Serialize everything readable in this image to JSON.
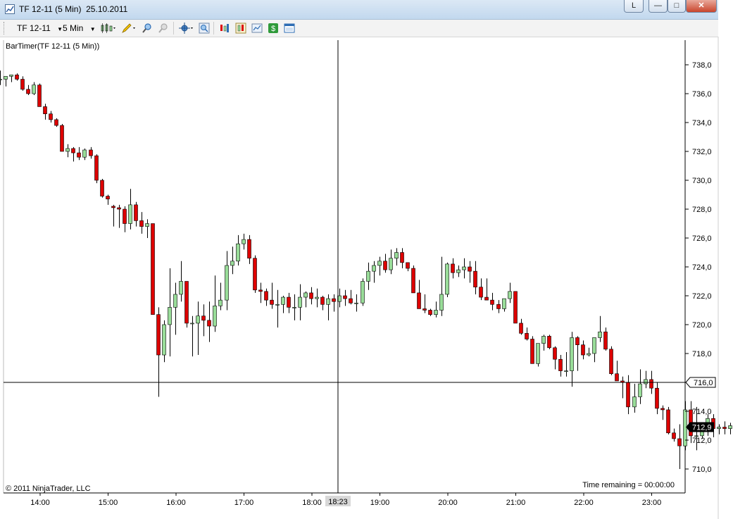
{
  "window": {
    "title": "TF 12-11 (5 Min)  25.10.2011",
    "link_button": "L",
    "minimize_glyph": "—",
    "maximize_glyph": "□",
    "close_glyph": "✕"
  },
  "toolbar": {
    "instrument": "TF 12-11",
    "interval": "5 Min",
    "icons": [
      "chart-style-icon",
      "drawing-pencil-icon",
      "zoom-in-icon",
      "zoom-out-icon",
      "crosshair-icon",
      "properties-icon",
      "indicators-icon",
      "strategies-icon",
      "data-box-icon",
      "dollar-icon",
      "window-icon"
    ]
  },
  "chart": {
    "indicator_label": "BarTimer(TF 12-11 (5 Min))",
    "copyright": "© 2011 NinjaTrader, LLC",
    "time_remaining": "Time remaining = 00:00:00",
    "crosshair_time": "18:23",
    "crosshair_price": "716,0",
    "last_price": "712,9",
    "colors": {
      "up": "#99dd99",
      "down": "#dd0000",
      "wick": "#000000",
      "crosshair": "#000000"
    }
  },
  "chart_data": {
    "type": "candlestick",
    "x_ticks": [
      "14:00",
      "15:00",
      "16:00",
      "17:00",
      "18:00",
      "19:00",
      "20:00",
      "21:00",
      "22:00",
      "23:00"
    ],
    "y_ticks": [
      "738,0",
      "736,0",
      "734,0",
      "732,0",
      "730,0",
      "728,0",
      "726,0",
      "724,0",
      "722,0",
      "720,0",
      "718,0",
      "716,0",
      "714,0",
      "712,0",
      "710,0"
    ],
    "ylim": [
      708.6,
      739.8
    ],
    "bar_interval_minutes": 5,
    "first_bar_time": "13:40",
    "candles": [
      [
        737.0,
        737.6,
        736.6,
        737.0
      ],
      [
        737.0,
        737.2,
        736.5,
        737.2
      ],
      [
        737.2,
        737.3,
        736.8,
        737.3
      ],
      [
        737.3,
        737.4,
        736.9,
        737.0
      ],
      [
        737.0,
        737.2,
        736.2,
        736.3
      ],
      [
        736.3,
        736.6,
        735.9,
        736.0
      ],
      [
        736.0,
        736.8,
        735.9,
        736.6
      ],
      [
        736.6,
        736.7,
        735.1,
        735.1
      ],
      [
        735.1,
        735.3,
        734.2,
        734.6
      ],
      [
        734.6,
        734.8,
        734.0,
        734.2
      ],
      [
        734.2,
        734.3,
        733.7,
        733.8
      ],
      [
        733.8,
        733.9,
        732.1,
        732.0
      ],
      [
        732.0,
        732.5,
        731.6,
        732.2
      ],
      [
        732.2,
        732.3,
        731.3,
        731.9
      ],
      [
        731.9,
        732.3,
        731.4,
        731.6
      ],
      [
        731.6,
        732.2,
        731.4,
        732.1
      ],
      [
        732.1,
        732.3,
        731.5,
        731.7
      ],
      [
        731.7,
        731.8,
        729.8,
        730.0
      ],
      [
        730.0,
        730.1,
        728.8,
        728.9
      ],
      [
        728.9,
        729.0,
        728.3,
        728.7
      ],
      [
        728.2,
        728.3,
        726.8,
        728.1
      ],
      [
        728.1,
        728.3,
        726.7,
        728.0
      ],
      [
        728.0,
        728.2,
        726.4,
        727.0
      ],
      [
        727.0,
        729.4,
        726.6,
        728.3
      ],
      [
        728.3,
        728.5,
        726.8,
        727.2
      ],
      [
        727.2,
        727.8,
        726.3,
        726.8
      ],
      [
        726.8,
        727.3,
        726.0,
        727.0
      ],
      [
        727.0,
        727.0,
        720.8,
        720.7
      ],
      [
        720.7,
        721.2,
        715.0,
        717.9
      ],
      [
        717.9,
        720.3,
        717.4,
        720.0
      ],
      [
        720.0,
        723.9,
        717.8,
        721.2
      ],
      [
        721.2,
        722.9,
        719.3,
        722.1
      ],
      [
        722.1,
        724.4,
        721.6,
        723.0
      ],
      [
        723.0,
        723.0,
        719.8,
        720.1
      ],
      [
        720.1,
        720.6,
        717.8,
        720.1
      ],
      [
        720.1,
        721.6,
        717.9,
        720.6
      ],
      [
        720.6,
        721.4,
        719.2,
        720.3
      ],
      [
        720.3,
        721.6,
        718.8,
        719.9
      ],
      [
        719.9,
        723.4,
        719.5,
        721.3
      ],
      [
        721.3,
        722.9,
        721.0,
        721.7
      ],
      [
        721.7,
        725.1,
        721.0,
        724.1
      ],
      [
        724.1,
        725.4,
        723.5,
        724.4
      ],
      [
        724.4,
        726.2,
        724.1,
        725.6
      ],
      [
        725.6,
        726.3,
        725.2,
        725.9
      ],
      [
        725.9,
        726.2,
        724.2,
        724.6
      ],
      [
        724.6,
        724.8,
        722.2,
        722.4
      ],
      [
        722.4,
        722.9,
        721.5,
        722.3
      ],
      [
        722.3,
        722.5,
        721.3,
        721.7
      ],
      [
        721.7,
        722.9,
        721.1,
        721.4
      ],
      [
        721.4,
        722.4,
        719.8,
        721.4
      ],
      [
        721.4,
        722.0,
        720.8,
        721.9
      ],
      [
        721.9,
        722.2,
        720.8,
        721.2
      ],
      [
        721.2,
        722.1,
        720.3,
        721.2
      ],
      [
        721.2,
        722.8,
        720.3,
        721.9
      ],
      [
        721.9,
        722.3,
        721.2,
        722.2
      ],
      [
        722.2,
        722.6,
        721.4,
        721.8
      ],
      [
        721.8,
        722.5,
        721.2,
        721.9
      ],
      [
        721.9,
        722.0,
        721.0,
        721.4
      ],
      [
        721.4,
        722.1,
        720.3,
        721.8
      ],
      [
        721.8,
        722.1,
        720.9,
        721.6
      ],
      [
        721.6,
        722.5,
        721.2,
        722.0
      ],
      [
        722.0,
        722.4,
        721.3,
        721.8
      ],
      [
        721.8,
        722.4,
        721.4,
        721.5
      ],
      [
        721.5,
        722.1,
        720.9,
        721.5
      ],
      [
        721.5,
        723.2,
        721.3,
        723.0
      ],
      [
        723.0,
        724.3,
        722.4,
        723.7
      ],
      [
        723.7,
        724.4,
        722.9,
        724.1
      ],
      [
        724.1,
        724.7,
        723.4,
        724.4
      ],
      [
        724.4,
        724.9,
        723.6,
        723.8
      ],
      [
        723.8,
        725.2,
        723.5,
        724.6
      ],
      [
        724.6,
        725.3,
        724.1,
        725.0
      ],
      [
        725.0,
        725.3,
        723.9,
        724.3
      ],
      [
        724.3,
        724.3,
        723.7,
        723.9
      ],
      [
        723.9,
        724.1,
        722.2,
        722.2
      ],
      [
        722.2,
        723.1,
        721.1,
        721.1
      ],
      [
        721.1,
        722.1,
        720.8,
        721.0
      ],
      [
        721.0,
        721.1,
        720.6,
        720.7
      ],
      [
        720.7,
        721.6,
        720.5,
        721.0
      ],
      [
        721.0,
        724.7,
        720.6,
        722.1
      ],
      [
        722.1,
        724.3,
        721.9,
        724.2
      ],
      [
        724.2,
        724.6,
        723.2,
        723.6
      ],
      [
        723.6,
        724.1,
        723.3,
        723.8
      ],
      [
        723.8,
        724.6,
        723.2,
        724.0
      ],
      [
        724.0,
        724.4,
        722.9,
        723.7
      ],
      [
        723.7,
        724.4,
        722.1,
        722.6
      ],
      [
        722.6,
        723.2,
        721.7,
        721.9
      ],
      [
        721.9,
        723.2,
        721.7,
        721.7
      ],
      [
        721.7,
        722.2,
        721.0,
        721.4
      ],
      [
        721.4,
        721.7,
        720.8,
        721.1
      ],
      [
        721.1,
        721.6,
        720.9,
        721.8
      ],
      [
        721.8,
        722.9,
        721.5,
        722.3
      ],
      [
        722.3,
        722.3,
        720.2,
        720.1
      ],
      [
        720.1,
        720.4,
        719.3,
        719.4
      ],
      [
        719.4,
        719.8,
        718.9,
        719.0
      ],
      [
        719.0,
        719.2,
        717.3,
        717.3
      ],
      [
        717.3,
        718.7,
        717.1,
        718.7
      ],
      [
        718.7,
        719.3,
        718.2,
        719.2
      ],
      [
        719.2,
        719.3,
        718.3,
        718.4
      ],
      [
        718.4,
        718.5,
        716.9,
        717.6
      ],
      [
        717.6,
        717.9,
        716.4,
        716.8
      ],
      [
        716.8,
        718.1,
        716.4,
        716.8
      ],
      [
        716.8,
        719.5,
        715.7,
        719.1
      ],
      [
        719.1,
        719.2,
        716.8,
        718.6
      ],
      [
        718.6,
        718.9,
        717.6,
        717.9
      ],
      [
        717.9,
        718.4,
        717.8,
        718.0
      ],
      [
        718.0,
        719.1,
        717.4,
        719.1
      ],
      [
        719.1,
        720.6,
        718.8,
        719.5
      ],
      [
        719.5,
        719.8,
        718.2,
        718.3
      ],
      [
        718.3,
        718.5,
        716.5,
        716.6
      ],
      [
        716.6,
        717.5,
        716.1,
        716.1
      ],
      [
        716.1,
        716.4,
        714.9,
        716.0
      ],
      [
        716.0,
        716.5,
        713.8,
        714.3
      ],
      [
        714.3,
        715.9,
        713.9,
        715.0
      ],
      [
        715.0,
        716.9,
        714.5,
        715.9
      ],
      [
        715.9,
        716.8,
        715.6,
        716.2
      ],
      [
        716.2,
        716.8,
        715.2,
        715.6
      ],
      [
        715.6,
        716.0,
        713.8,
        714.2
      ],
      [
        714.2,
        714.4,
        713.4,
        714.1
      ],
      [
        714.1,
        714.3,
        712.4,
        712.5
      ],
      [
        712.5,
        712.8,
        711.9,
        712.1
      ],
      [
        712.1,
        713.1,
        710.0,
        711.6
      ],
      [
        711.6,
        714.7,
        711.3,
        714.1
      ],
      [
        714.1,
        714.7,
        711.8,
        712.3
      ],
      [
        712.3,
        714.3,
        711.3,
        712.3
      ],
      [
        712.3,
        712.7,
        712.1,
        712.6
      ],
      [
        712.6,
        713.8,
        712.3,
        713.5
      ],
      [
        713.5,
        713.8,
        712.2,
        712.8
      ],
      [
        712.8,
        713.1,
        712.4,
        712.9
      ],
      [
        712.9,
        713.3,
        712.4,
        712.8
      ],
      [
        712.8,
        713.2,
        712.4,
        713.0
      ],
      [
        713.0,
        713.2,
        712.6,
        713.1
      ],
      [
        713.1,
        713.2,
        712.5,
        712.7
      ],
      [
        712.7,
        712.8,
        712.2,
        712.6
      ],
      [
        712.6,
        712.7,
        711.9,
        712.1
      ],
      [
        712.1,
        712.6,
        711.8,
        712.3
      ],
      [
        712.3,
        713.2,
        712.1,
        713.0
      ],
      [
        713.0,
        713.3,
        712.6,
        712.9
      ],
      [
        712.9,
        713.1,
        712.5,
        712.8
      ],
      [
        712.8,
        713.1,
        712.3,
        712.8
      ],
      [
        712.8,
        713.1,
        712.5,
        712.6
      ],
      [
        712.6,
        713.0,
        712.4,
        712.9
      ],
      [
        712.9,
        713.0,
        712.7,
        712.8
      ],
      [
        712.8,
        713.4,
        712.6,
        712.9
      ]
    ]
  }
}
